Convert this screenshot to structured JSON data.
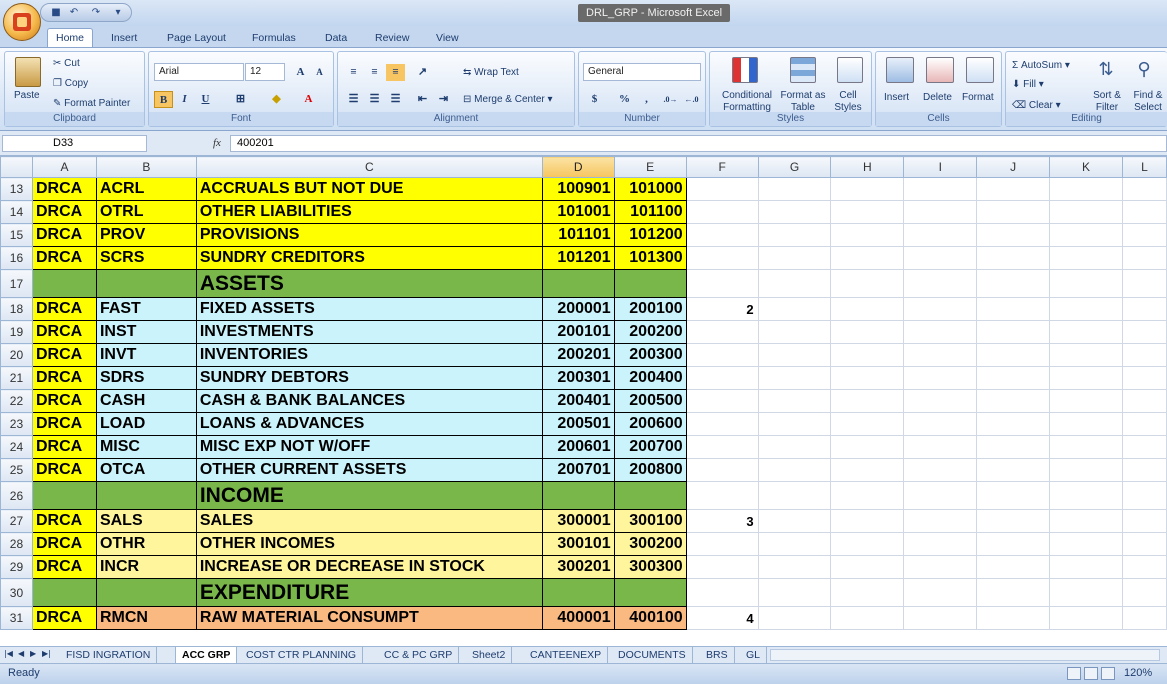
{
  "window": {
    "title": "DRL_GRP - Microsoft Excel"
  },
  "ribbon_tabs": [
    "Home",
    "Insert",
    "Page Layout",
    "Formulas",
    "Data",
    "Review",
    "View"
  ],
  "clipboard": {
    "paste": "Paste",
    "cut": "Cut",
    "copy": "Copy",
    "format_painter": "Format Painter",
    "label": "Clipboard"
  },
  "font": {
    "name": "Arial",
    "size": "12",
    "label": "Font",
    "bold": "B",
    "italic": "I",
    "underline": "U"
  },
  "alignment": {
    "wrap_text": "Wrap Text",
    "merge_center": "Merge & Center",
    "label": "Alignment"
  },
  "number": {
    "format": "General",
    "label": "Number",
    "currency": "$",
    "percent": "%",
    "comma": ","
  },
  "styles": {
    "conditional": "Conditional Formatting",
    "format_table": "Format as Table",
    "cell_styles": "Cell Styles",
    "label": "Styles"
  },
  "cells": {
    "insert": "Insert",
    "delete": "Delete",
    "format": "Format",
    "label": "Cells"
  },
  "editing": {
    "autosum": "AutoSum",
    "fill": "Fill",
    "clear": "Clear",
    "sort_filter": "Sort & Filter",
    "find_select": "Find & Select",
    "label": "Editing"
  },
  "formula_bar": {
    "name_box": "D33",
    "fx": "fx",
    "value": "400201"
  },
  "columns": [
    "A",
    "B",
    "C",
    "D",
    "E",
    "F",
    "G",
    "H",
    "I",
    "J",
    "K",
    "L"
  ],
  "rows": [
    {
      "num": "13",
      "a": "DRCA",
      "b": "ACRL",
      "c": "ACCRUALS BUT NOT DUE",
      "d": "100901",
      "e": "101000",
      "f": "",
      "style": "y"
    },
    {
      "num": "14",
      "a": "DRCA",
      "b": "OTRL",
      "c": "OTHER LIABILITIES",
      "d": "101001",
      "e": "101100",
      "f": "",
      "style": "y"
    },
    {
      "num": "15",
      "a": "DRCA",
      "b": "PROV",
      "c": "PROVISIONS",
      "d": "101101",
      "e": "101200",
      "f": "",
      "style": "y"
    },
    {
      "num": "16",
      "a": "DRCA",
      "b": "SCRS",
      "c": "SUNDRY CREDITORS",
      "d": "101201",
      "e": "101300",
      "f": "",
      "style": "y"
    },
    {
      "num": "17",
      "a": "",
      "b": "",
      "c": "ASSETS",
      "d": "",
      "e": "",
      "f": "",
      "style": "g"
    },
    {
      "num": "18",
      "a": "DRCA",
      "b": "FAST",
      "c": "FIXED ASSETS",
      "d": "200001",
      "e": "200100",
      "f": "2",
      "style": "c"
    },
    {
      "num": "19",
      "a": "DRCA",
      "b": "INST",
      "c": "INVESTMENTS",
      "d": "200101",
      "e": "200200",
      "f": "",
      "style": "c"
    },
    {
      "num": "20",
      "a": "DRCA",
      "b": "INVT",
      "c": "INVENTORIES",
      "d": "200201",
      "e": "200300",
      "f": "",
      "style": "c"
    },
    {
      "num": "21",
      "a": "DRCA",
      "b": "SDRS",
      "c": "SUNDRY DEBTORS",
      "d": "200301",
      "e": "200400",
      "f": "",
      "style": "c"
    },
    {
      "num": "22",
      "a": "DRCA",
      "b": "CASH",
      "c": "CASH & BANK BALANCES",
      "d": "200401",
      "e": "200500",
      "f": "",
      "style": "c"
    },
    {
      "num": "23",
      "a": "DRCA",
      "b": "LOAD",
      "c": "LOANS & ADVANCES",
      "d": "200501",
      "e": "200600",
      "f": "",
      "style": "c"
    },
    {
      "num": "24",
      "a": "DRCA",
      "b": "MISC",
      "c": "MISC EXP NOT W/OFF",
      "d": "200601",
      "e": "200700",
      "f": "",
      "style": "c"
    },
    {
      "num": "25",
      "a": "DRCA",
      "b": "OTCA",
      "c": "OTHER CURRENT ASSETS",
      "d": "200701",
      "e": "200800",
      "f": "",
      "style": "c"
    },
    {
      "num": "26",
      "a": "",
      "b": "",
      "c": "INCOME",
      "d": "",
      "e": "",
      "f": "",
      "style": "g"
    },
    {
      "num": "27",
      "a": "DRCA",
      "b": "SALS",
      "c": "SALES",
      "d": "300001",
      "e": "300100",
      "f": "3",
      "style": "ly"
    },
    {
      "num": "28",
      "a": "DRCA",
      "b": "OTHR",
      "c": "OTHER INCOMES",
      "d": "300101",
      "e": "300200",
      "f": "",
      "style": "ly"
    },
    {
      "num": "29",
      "a": "DRCA",
      "b": "INCR",
      "c": "INCREASE OR DECREASE IN STOCK",
      "d": "300201",
      "e": "300300",
      "f": "",
      "style": "ly"
    },
    {
      "num": "30",
      "a": "",
      "b": "",
      "c": "EXPENDITURE",
      "d": "",
      "e": "",
      "f": "",
      "style": "g"
    },
    {
      "num": "31",
      "a": "DRCA",
      "b": "RMCN",
      "c": "RAW MATERIAL CONSUMPT",
      "d": "400001",
      "e": "400100",
      "f": "4",
      "style": "o"
    }
  ],
  "sheet_tabs": [
    "FISD INGRATION",
    "ACC GRP",
    "COST CTR PLANNING",
    "CC & PC GRP",
    "Sheet2",
    "CANTEENEXP",
    "DOCUMENTS",
    "BRS",
    "GL"
  ],
  "active_sheet": "ACC GRP",
  "status": {
    "ready": "Ready",
    "zoom": "120%"
  },
  "colors": {
    "yellow": "#ffff00",
    "cyan": "#cbf3fb",
    "green": "#7ab74a",
    "light_yellow": "#fff59c",
    "orange": "#fbb982"
  }
}
